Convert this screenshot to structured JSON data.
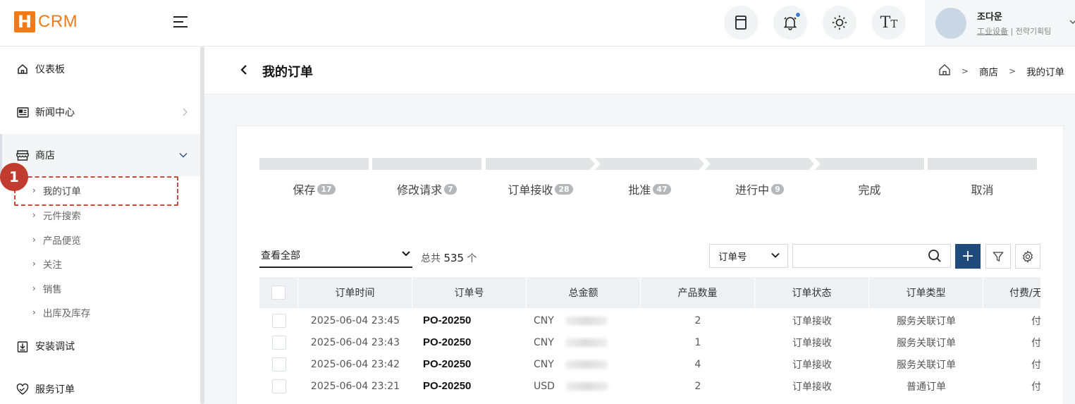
{
  "header": {
    "logo_mark": "H",
    "logo_text": "CRM",
    "user": {
      "name": "조다운",
      "org_main": "工业设备",
      "org_sub": " | 전략기획팀"
    }
  },
  "sidebar": {
    "items": [
      {
        "label": "仪表板",
        "icon": "home-icon"
      },
      {
        "label": "新闻中心",
        "icon": "news-icon"
      },
      {
        "label": "商店",
        "icon": "store-icon"
      },
      {
        "label": "安装调试",
        "icon": "install-icon"
      },
      {
        "label": "服务订单",
        "icon": "heart-handshake-icon"
      }
    ],
    "store_sub": [
      "我的订单",
      "元件搜索",
      "产品便览",
      "关注",
      "销售",
      "出库及库存"
    ],
    "callout_number": "1"
  },
  "page": {
    "title": "我的订单",
    "breadcrumb": [
      "商店",
      "我的订单"
    ]
  },
  "steps": [
    {
      "label": "保存",
      "count": "17"
    },
    {
      "label": "修改请求",
      "count": "7"
    },
    {
      "label": "订单接收",
      "count": "28"
    },
    {
      "label": "批准",
      "count": "47"
    },
    {
      "label": "进行中",
      "count": "9"
    },
    {
      "label": "完成",
      "count": ""
    },
    {
      "label": "取消",
      "count": ""
    }
  ],
  "toolbar": {
    "view_label": "查看全部",
    "total_prefix": "总共",
    "total_count": "535",
    "total_suffix": "个",
    "field_label": "订单号",
    "add_label": "+"
  },
  "table": {
    "columns": [
      "订单时间",
      "订单号",
      "总金额",
      "产品数量",
      "订单状态",
      "订单类型",
      "付费/无"
    ],
    "rows": [
      {
        "time": "2025-06-04 23:45",
        "po": "PO-20250",
        "currency": "CNY",
        "qty": "2",
        "status": "订单接收",
        "type": "服务关联订单",
        "pay": "付"
      },
      {
        "time": "2025-06-04 23:43",
        "po": "PO-20250",
        "currency": "CNY",
        "qty": "1",
        "status": "订单接收",
        "type": "服务关联订单",
        "pay": "付"
      },
      {
        "time": "2025-06-04 23:42",
        "po": "PO-20250",
        "currency": "CNY",
        "qty": "4",
        "status": "订单接收",
        "type": "服务关联订单",
        "pay": "付"
      },
      {
        "time": "2025-06-04 23:21",
        "po": "PO-20250",
        "currency": "USD",
        "qty": "2",
        "status": "订单接收",
        "type": "普通订单",
        "pay": "付"
      }
    ]
  }
}
